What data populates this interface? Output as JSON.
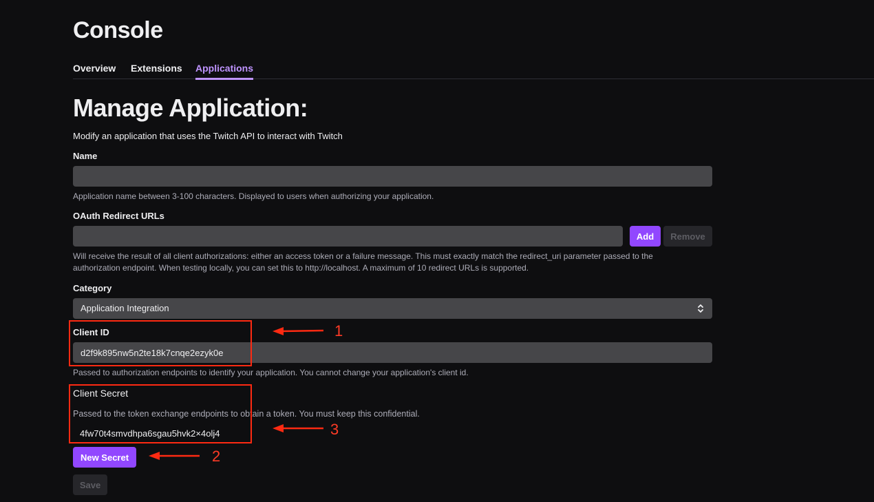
{
  "header": {
    "title": "Console",
    "tabs": [
      {
        "label": "Overview",
        "active": false
      },
      {
        "label": "Extensions",
        "active": false
      },
      {
        "label": "Applications",
        "active": true
      }
    ]
  },
  "page": {
    "title": "Manage Application:",
    "subtitle": "Modify an application that uses the Twitch API to interact with Twitch"
  },
  "form": {
    "name": {
      "label": "Name",
      "value": "",
      "hint": "Application name between 3-100 characters. Displayed to users when authorizing your application."
    },
    "redirect": {
      "label": "OAuth Redirect URLs",
      "value": "",
      "add_label": "Add",
      "remove_label": "Remove",
      "hint_line1": "Will receive the result of all client authorizations: either an access token or a failure message. This must exactly match the redirect_uri parameter passed to the",
      "hint_line2": "authorization endpoint. When testing locally, you can set this to http://localhost. A maximum of 10 redirect URLs is supported."
    },
    "category": {
      "label": "Category",
      "selected": "Application Integration",
      "icon": "select-caret-icon"
    },
    "client_id": {
      "label": "Client ID",
      "value": "d2f9k895nw5n2te18k7cnqe2ezyk0e",
      "hint": "Passed to authorization endpoints to identify your application. You cannot change your application's client id."
    },
    "client_secret": {
      "label": "Client Secret",
      "hint": "Passed to the token exchange endpoints to obtain a token. You must keep this confidential.",
      "value": "4fw70t4smvdhpa6sgau5hvk2×4olj4",
      "new_secret_label": "New Secret"
    },
    "save_label": "Save"
  },
  "annotations": [
    {
      "number": "1",
      "target": "Client ID"
    },
    {
      "number": "2",
      "target": "New Secret"
    },
    {
      "number": "3",
      "target": "Client Secret value"
    }
  ],
  "colors": {
    "background": "#0e0e10",
    "accent": "#9147ff",
    "tab_active": "#bf94ff",
    "input_bg": "#464649",
    "annotation": "#ff2a12"
  }
}
